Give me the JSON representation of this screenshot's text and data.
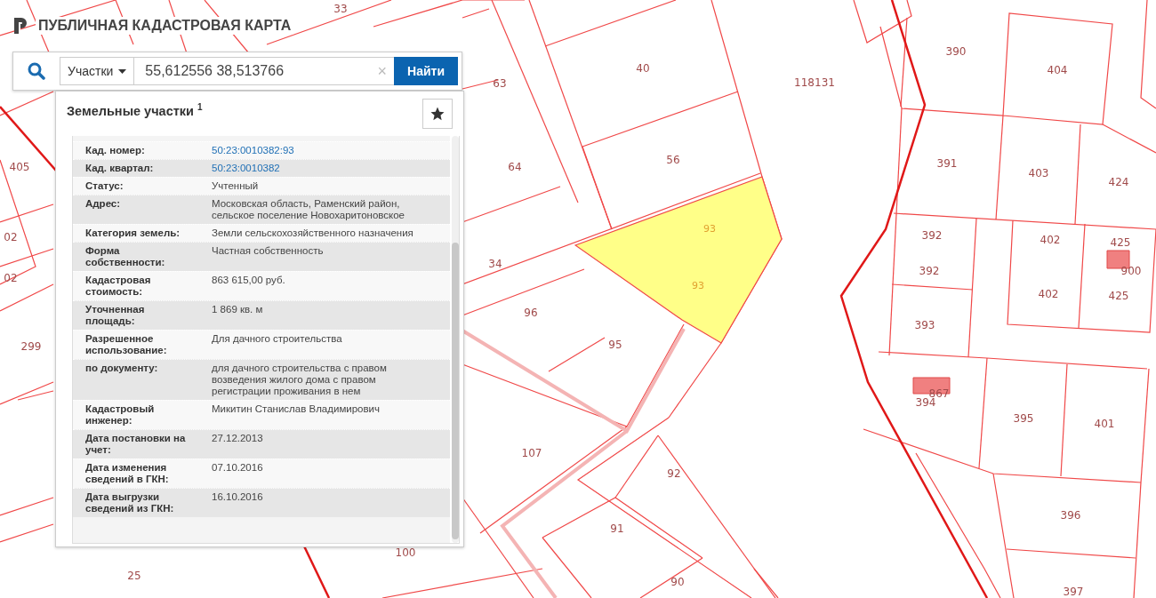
{
  "header": {
    "title": "ПУБЛИЧНАЯ КАДАСТРОВАЯ КАРТА"
  },
  "search": {
    "category": "Участки",
    "value": "55,612556 38,513766",
    "clear": "×",
    "button": "Найти"
  },
  "panel": {
    "title": "Земельные участки $^{1}$",
    "rows": [
      {
        "label": "Кад. номер:",
        "value": "50:23:0010382:93",
        "kind": "link"
      },
      {
        "label": "Кад. квартал:",
        "value": "50:23:0010382",
        "kind": "link"
      },
      {
        "label": "Статус:",
        "value": "Учтенный",
        "kind": "text"
      },
      {
        "label": "Адрес:",
        "value": "Московская область, Раменский район, сельское поселение Новохаритоновское",
        "kind": "text"
      },
      {
        "label": "Категория земель:",
        "value": "Земли сельскохозяйственного назначения",
        "kind": "text"
      },
      {
        "label": "Форма собственности:",
        "value": "Частная собственность",
        "kind": "text"
      },
      {
        "label": "Кадастровая стоимость:",
        "value": "863 615,00 руб.",
        "kind": "text"
      },
      {
        "label": "Уточненная площадь:",
        "value": "1 869 кв. м",
        "kind": "text"
      },
      {
        "label": "Разрешенное использование:",
        "value": "Для дачного строительства",
        "kind": "text"
      },
      {
        "label": "по документу:",
        "value": "для дачного строительства с правом возведения жилого дома с правом регистрации проживания в нем",
        "kind": "text"
      },
      {
        "label": "Кадастровый инженер:",
        "value": "Микитин Станислав Владимирович",
        "kind": "text"
      },
      {
        "label": "Дата постановки на учет:",
        "value": "27.12.2013",
        "kind": "text"
      },
      {
        "label": "Дата изменения сведений в ГКН:",
        "value": "07.10.2016",
        "kind": "text"
      },
      {
        "label": "Дата выгрузки сведений из ГКН:",
        "value": "16.10.2016",
        "kind": "text"
      }
    ]
  },
  "map": {
    "parcel_labels": [
      "33",
      "40",
      "63",
      "64",
      "56",
      "118131",
      "390",
      "404",
      "391",
      "403",
      "424",
      "392",
      "402",
      "425",
      "392",
      "402",
      "425",
      "393",
      "34",
      "96",
      "95",
      "299",
      "394",
      "395",
      "401",
      "107",
      "92",
      "396",
      "91",
      "100",
      "25",
      "90",
      "397",
      "405",
      "02",
      "02",
      "900",
      "867"
    ],
    "selected_parcel_labels": [
      "93",
      "93"
    ]
  }
}
